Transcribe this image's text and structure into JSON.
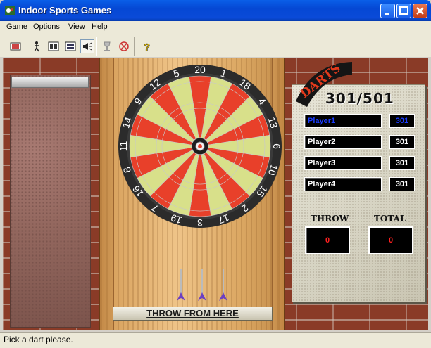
{
  "window": {
    "title": "Indoor Sports Games"
  },
  "menu": [
    "Game",
    "Options",
    "View",
    "Help"
  ],
  "toolbar": [
    "new-game-icon",
    "player-icon",
    "two-players-icon",
    "scoreboard-icon",
    "sound-icon",
    "trophy-icon",
    "no-sound-icon",
    "help-icon"
  ],
  "board": {
    "numbers": [
      "20",
      "1",
      "18",
      "4",
      "13",
      "6",
      "10",
      "15",
      "2",
      "17",
      "3",
      "19",
      "7",
      "16",
      "8",
      "11",
      "14",
      "9",
      "12",
      "5"
    ]
  },
  "game": {
    "logo": "DARTS",
    "mode": "301/501",
    "throw_label": "THROW FROM HERE"
  },
  "players": [
    {
      "name": "Player1",
      "score": "301",
      "active": true
    },
    {
      "name": "Player2",
      "score": "301",
      "active": false
    },
    {
      "name": "Player3",
      "score": "301",
      "active": false
    },
    {
      "name": "Player4",
      "score": "301",
      "active": false
    }
  ],
  "stats": {
    "throw_label": "THROW",
    "throw_value": "0",
    "total_label": "TOTAL",
    "total_value": "0"
  },
  "status": {
    "text": "Pick a dart please."
  },
  "colors": {
    "red": "#e8402a",
    "cream": "#d8e08a",
    "blue": "#1a3cff"
  }
}
